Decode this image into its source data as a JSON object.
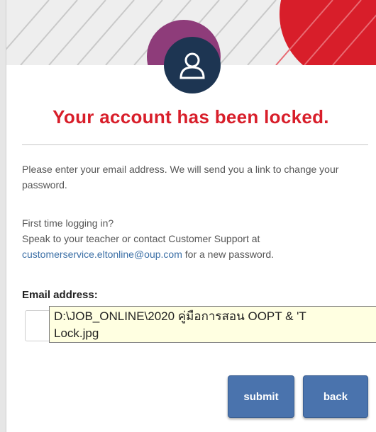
{
  "header": {
    "avatar_icon": "user-avatar-icon"
  },
  "title": "Your account has been locked.",
  "instructions": "Please enter your email address. We will send you a link to change your password.",
  "first_time": {
    "heading": "First time logging in?",
    "line1": "Speak to your teacher or contact Customer Support at",
    "email_link": "customerservice.eltonline@oup.com",
    "line2_suffix": " for a new password."
  },
  "form": {
    "email_label": "Email address:",
    "email_value": "",
    "submit_label": "submit",
    "back_label": "back"
  },
  "tooltip": {
    "line1": "D:\\JOB_ONLINE\\2020 คู่มือการสอน OOPT & 'T",
    "line2": "Lock.jpg"
  },
  "colors": {
    "title": "#d81e2a",
    "avatar_bg": "#1d3552",
    "button": "#4a73ad",
    "link": "#3b6fa6"
  }
}
